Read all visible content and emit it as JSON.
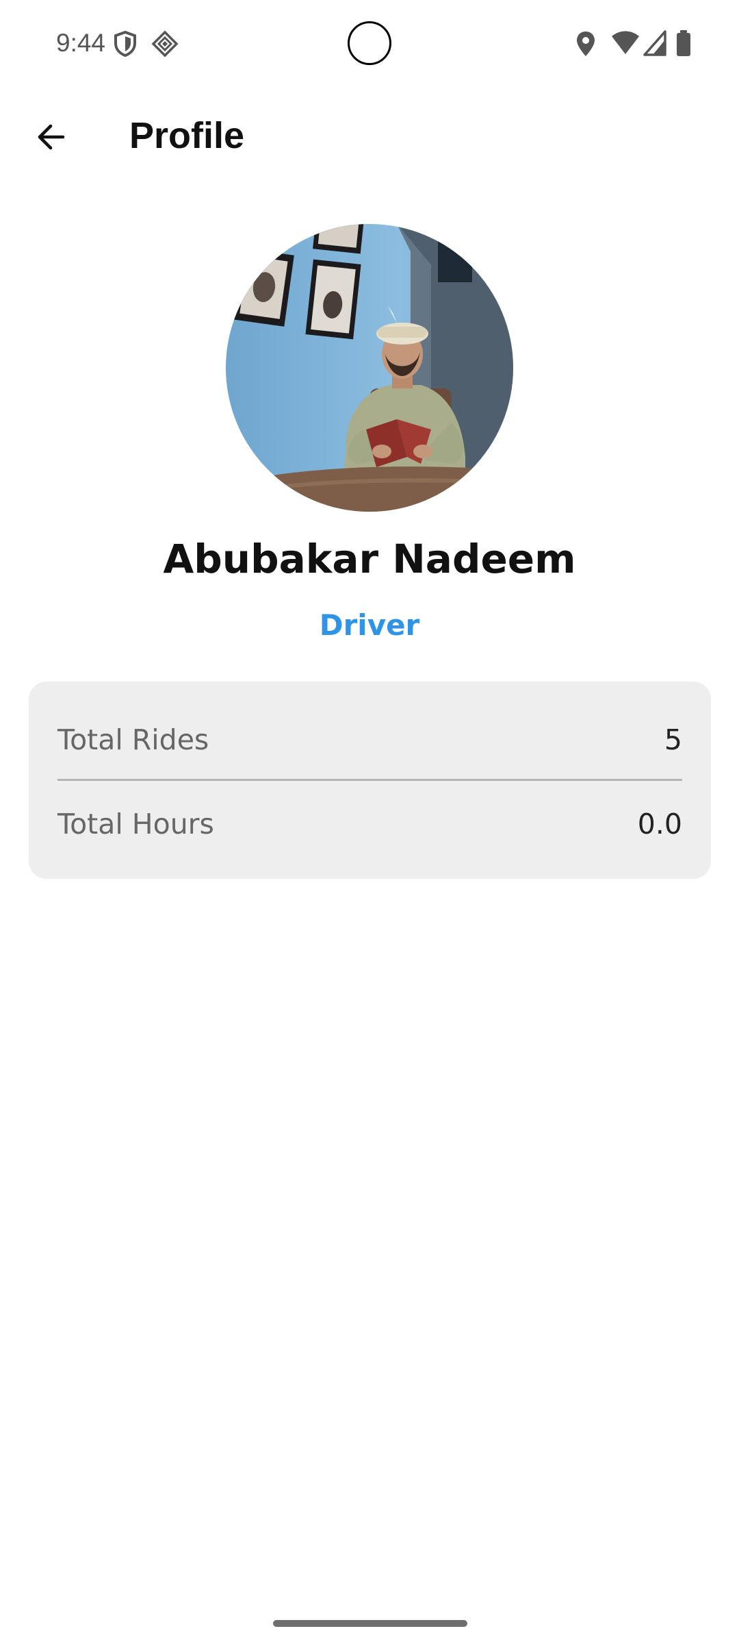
{
  "status_bar": {
    "time": "9:44",
    "left_icons": [
      "shield-icon",
      "sparkle-diamond-icon"
    ],
    "right_icons": [
      "location-pin-icon",
      "wifi-icon",
      "cellular-signal-icon",
      "battery-icon"
    ]
  },
  "app_bar": {
    "back_icon": "arrow-left-icon",
    "title": "Profile"
  },
  "profile": {
    "name": "Abubakar Nadeem",
    "role": "Driver",
    "role_color": "#2f93e6"
  },
  "stats": [
    {
      "label": "Total Rides",
      "value": "5"
    },
    {
      "label": "Total Hours",
      "value": "0.0"
    }
  ],
  "colors": {
    "card_background": "#eeeeee",
    "accent": "#2f93e6"
  }
}
